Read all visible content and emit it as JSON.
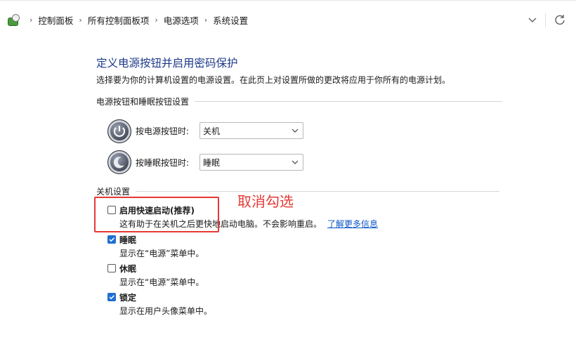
{
  "breadcrumb": {
    "items": [
      "控制面板",
      "所有控制面板项",
      "电源选项",
      "系统设置"
    ]
  },
  "icons": {
    "app": "control-panel-icon",
    "address_dropdown": "chevron-down-icon",
    "refresh": "refresh-icon",
    "power_button": "power-icon",
    "sleep_button": "sleep-moon-icon"
  },
  "page": {
    "title": "定义电源按钮并启用密码保护",
    "description": "选择要为你的计算机设置的电源设置。在此页上对设置所做的更改将应用于你所有的电源计划。"
  },
  "button_settings": {
    "heading": "电源按钮和睡眠按钮设置",
    "power_label": "按电源按钮时:",
    "power_value": "关机",
    "sleep_label": "按睡眠按钮时:",
    "sleep_value": "睡眠"
  },
  "shutdown_settings": {
    "heading": "关机设置",
    "options": [
      {
        "label": "启用快速启动(推荐)",
        "checked": false,
        "desc": "这有助于在关机之后更快地启动电脑。不会影响重启。",
        "link": "了解更多信息"
      },
      {
        "label": "睡眠",
        "checked": true,
        "desc": "显示在“电源”菜单中。"
      },
      {
        "label": "休眠",
        "checked": false,
        "desc": "显示在“电源”菜单中。"
      },
      {
        "label": "锁定",
        "checked": true,
        "desc": "显示在用户头像菜单中。"
      }
    ]
  },
  "annotation": {
    "text": "取消勾选",
    "color": "#e53935"
  },
  "colors": {
    "title": "#1e3a8a",
    "link": "#0b57c6",
    "checkbox_checked": "#1f6fd1"
  }
}
